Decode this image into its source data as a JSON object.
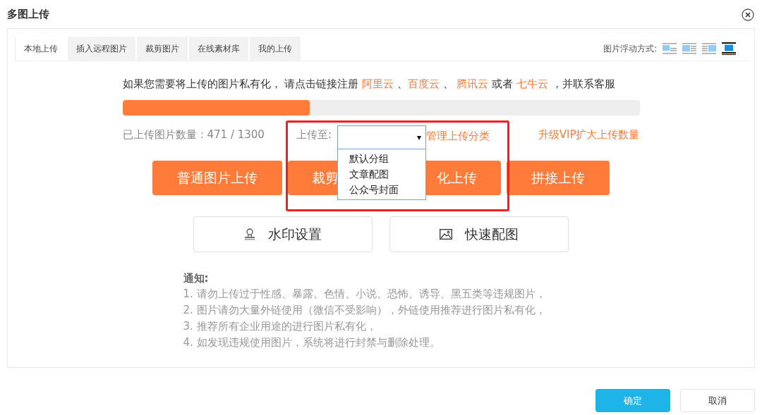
{
  "dialog": {
    "title": "多图上传"
  },
  "tabs": [
    {
      "label": "本地上传",
      "selected": true
    },
    {
      "label": "插入远程图片",
      "selected": false
    },
    {
      "label": "裁剪图片",
      "selected": false
    },
    {
      "label": "在线素材库",
      "selected": false
    },
    {
      "label": "我的上传",
      "selected": false
    }
  ],
  "float_mode": {
    "label": "图片浮动方式:",
    "options": [
      {
        "kind": "inline",
        "selected": false
      },
      {
        "kind": "left",
        "selected": false
      },
      {
        "kind": "right",
        "selected": false
      },
      {
        "kind": "center",
        "selected": true
      }
    ]
  },
  "privacy_notice": {
    "parts": [
      {
        "text": "如果您需要将上传的图片私有化， 请点击链接注册 ",
        "kind": "text"
      },
      {
        "text": "阿里云",
        "kind": "link"
      },
      {
        "text": " 、",
        "kind": "text"
      },
      {
        "text": "百度云",
        "kind": "link"
      },
      {
        "text": " 、 ",
        "kind": "text"
      },
      {
        "text": "腾讯云",
        "kind": "link"
      },
      {
        "text": " 或者 ",
        "kind": "text"
      },
      {
        "text": "七牛云",
        "kind": "link"
      },
      {
        "text": " ，并联系客服",
        "kind": "text"
      }
    ]
  },
  "quota": {
    "level": 0.362,
    "label": "已上传图片数量：471 / 1300",
    "upgrade_link": "升级VIP扩大上传数量"
  },
  "upload_to": {
    "label": "上传至:",
    "caret": "▾",
    "manage_link": "管理上传分类",
    "options": [
      {
        "label": "默认分组",
        "selected": false
      },
      {
        "label": "文章配图",
        "selected": false
      },
      {
        "label": "公众号封面",
        "selected": false
      }
    ]
  },
  "upload_buttons": [
    {
      "text_start": "普通图片上传"
    },
    {
      "text_start": "裁剪",
      "text_end": "化上传"
    },
    {
      "text_start": "拼接上传"
    }
  ],
  "tool_buttons": [
    {
      "kind": "watermark",
      "label": "水印设置"
    },
    {
      "kind": "picture",
      "label": "快速配图"
    }
  ],
  "notice": {
    "title": "通知:",
    "lines": [
      "1. 请勿上传过于性感、暴露、色情、小说、恐怖、诱导、黑五类等违规图片，",
      "2. 图片请勿大量外链使用（微信不受影响），外链使用推荐进行图片私有化，",
      "3. 推荐所有企业用途的进行图片私有化，",
      "4. 如发现违规使用图片，系统将进行封禁与删除处理。"
    ]
  },
  "footer": {
    "confirm": "确定",
    "cancel": "取消"
  }
}
